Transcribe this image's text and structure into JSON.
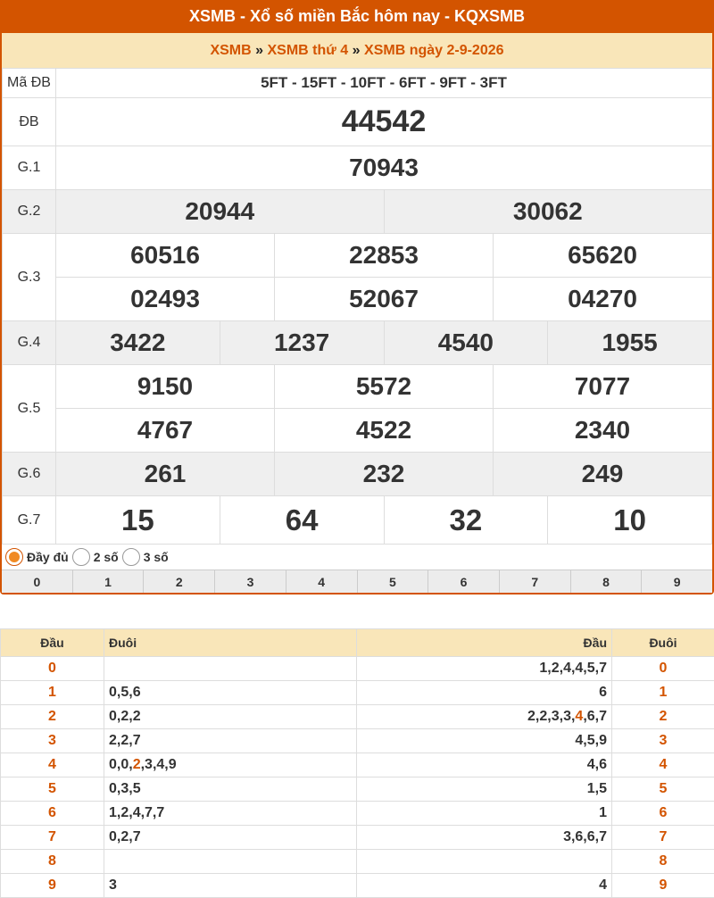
{
  "header": {
    "title": "XSMB - Xổ số miền Bắc hôm nay - KQXSMB"
  },
  "breadcrumb": {
    "link1": "XSMB",
    "sep": "»",
    "link2": "XSMB thứ 4",
    "link3": "XSMB ngày 2-9-2026"
  },
  "results": {
    "ma_db_label": "Mã ĐB",
    "ma_db": "5FT - 15FT - 10FT - 6FT - 9FT - 3FT",
    "db_label": "ĐB",
    "db": "44542",
    "g1_label": "G.1",
    "g1": "70943",
    "g2_label": "G.2",
    "g2": [
      "20944",
      "30062"
    ],
    "g3_label": "G.3",
    "g3": [
      "60516",
      "22853",
      "65620",
      "02493",
      "52067",
      "04270"
    ],
    "g4_label": "G.4",
    "g4": [
      "3422",
      "1237",
      "4540",
      "1955"
    ],
    "g5_label": "G.5",
    "g5": [
      "9150",
      "5572",
      "7077",
      "4767",
      "4522",
      "2340"
    ],
    "g6_label": "G.6",
    "g6": [
      "261",
      "232",
      "249"
    ],
    "g7_label": "G.7",
    "g7": [
      "15",
      "64",
      "32",
      "10"
    ]
  },
  "options": {
    "full": "Đầy đủ",
    "two": "2 số",
    "three": "3 số",
    "selected": "full"
  },
  "digits": [
    "0",
    "1",
    "2",
    "3",
    "4",
    "5",
    "6",
    "7",
    "8",
    "9"
  ],
  "loto": {
    "headers": {
      "dau": "Đầu",
      "duoi": "Đuôi",
      "dau2": "Đầu",
      "duoi2": "Đuôi"
    },
    "rows": [
      {
        "head": "0",
        "tails": "",
        "heads": "1,2,4,4,5,7",
        "tail": "0"
      },
      {
        "head": "1",
        "tails": "0,5,6",
        "heads": "6",
        "tail": "1"
      },
      {
        "head": "2",
        "tails": "0,2,2",
        "heads_pre": "2,2,3,3,",
        "heads_hl": "4",
        "heads_post": ",6,7",
        "tail": "2"
      },
      {
        "head": "3",
        "tails": "2,2,7",
        "heads": "4,5,9",
        "tail": "3"
      },
      {
        "head": "4",
        "tails_pre": "0,0,",
        "tails_hl": "2",
        "tails_post": ",3,4,9",
        "heads": "4,6",
        "tail": "4"
      },
      {
        "head": "5",
        "tails": "0,3,5",
        "heads": "1,5",
        "tail": "5"
      },
      {
        "head": "6",
        "tails": "1,2,4,7,7",
        "heads": "1",
        "tail": "6"
      },
      {
        "head": "7",
        "tails": "0,2,7",
        "heads": "3,6,6,7",
        "tail": "7"
      },
      {
        "head": "8",
        "tails": "",
        "heads": "",
        "tail": "8"
      },
      {
        "head": "9",
        "tails": "3",
        "heads": "4",
        "tail": "9"
      }
    ]
  },
  "colors": {
    "accent": "#d35400",
    "crumb_bg": "#f9e6b9",
    "blue": "#0a57a6"
  }
}
